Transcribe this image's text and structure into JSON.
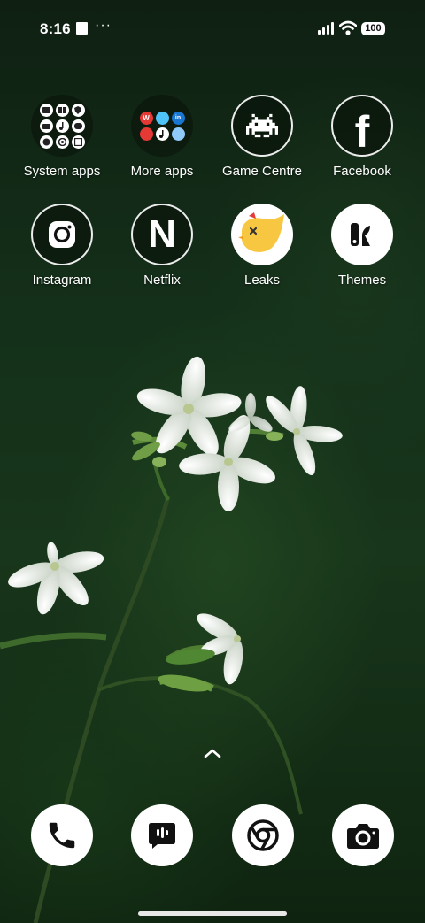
{
  "status_bar": {
    "time": "8:16",
    "dots": "···",
    "battery": "100"
  },
  "apps": {
    "system_apps": "System apps",
    "more_apps": "More apps",
    "game_centre": "Game Centre",
    "facebook": "Facebook",
    "instagram": "Instagram",
    "netflix": "Netflix",
    "leaks": "Leaks",
    "themes": "Themes"
  },
  "icons": {
    "netflix_letter": "N",
    "facebook_letter": "f",
    "more_apps_minis": [
      "W",
      "",
      "in",
      "",
      "",
      ""
    ]
  },
  "dock": [
    "phone-icon",
    "messages-icon",
    "chrome-icon",
    "camera-icon"
  ],
  "colors": {
    "background": "#14301a",
    "leaks_yellow": "#f7c742",
    "accent_white": "#ffffff"
  }
}
